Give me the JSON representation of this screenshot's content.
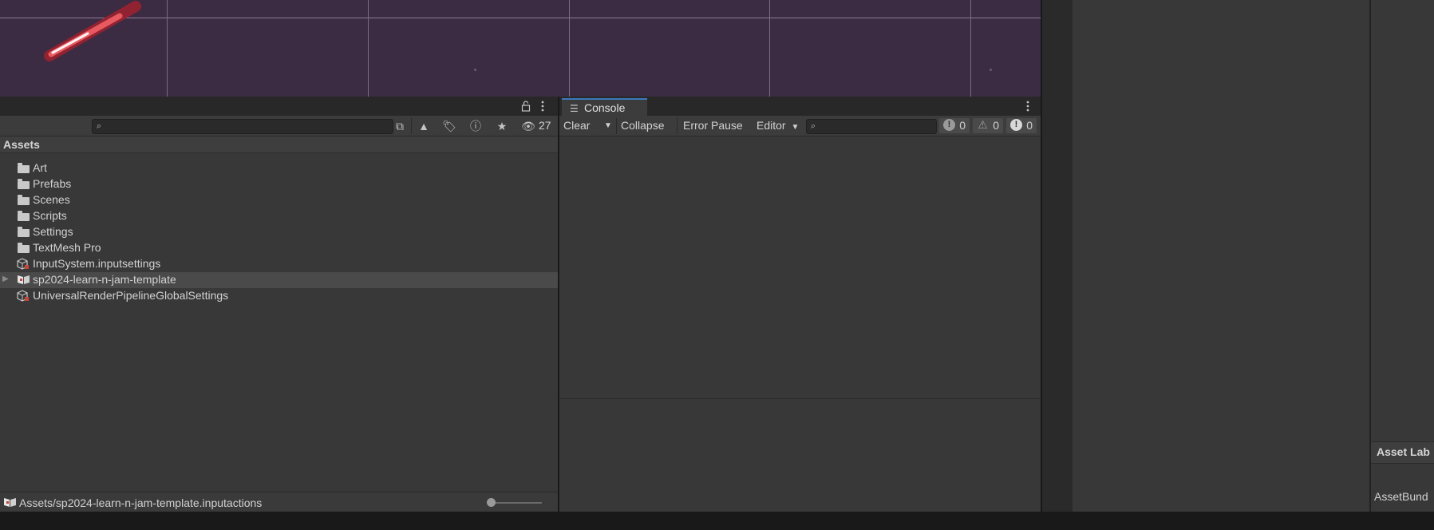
{
  "project": {
    "search_placeholder": "",
    "hidden_count": "27",
    "root_label": "Assets",
    "items": [
      {
        "label": "Art",
        "icon": "folder-icon"
      },
      {
        "label": "Prefabs",
        "icon": "folder-icon"
      },
      {
        "label": "Scenes",
        "icon": "folder-icon"
      },
      {
        "label": "Scripts",
        "icon": "folder-icon"
      },
      {
        "label": "Settings",
        "icon": "folder-icon"
      },
      {
        "label": "TextMesh Pro",
        "icon": "folder-icon"
      },
      {
        "label": "InputSystem.inputsettings",
        "icon": "settings-asset-icon"
      },
      {
        "label": "sp2024-learn-n-jam-template",
        "icon": "input-actions-icon",
        "selected": true
      },
      {
        "label": "UniversalRenderPipelineGlobalSettings",
        "icon": "settings-asset-icon"
      }
    ],
    "footer_path": "Assets/sp2024-learn-n-jam-template.inputactions"
  },
  "console": {
    "tab_label": "Console",
    "clear": "Clear",
    "collapse": "Collapse",
    "error_pause": "Error Pause",
    "editor": "Editor",
    "log_count": "0",
    "warning_count": "0",
    "error_count": "0"
  },
  "right_panel": {
    "asset_labels_header": "Asset Lab",
    "asset_bundle_label": "AssetBund"
  },
  "colors": {
    "scene_bg": "#3b2b43",
    "panel_bg": "#383838",
    "tab_accent": "#3a79bb"
  }
}
